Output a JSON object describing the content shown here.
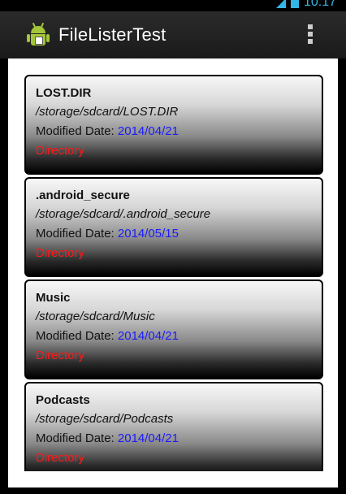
{
  "status_bar": {
    "time": "10:17",
    "icons": [
      "signal-icon",
      "battery-icon"
    ],
    "accent_color": "#33b5e5"
  },
  "action_bar": {
    "app_icon": "android-icon",
    "title": "FileListerTest",
    "overflow_icon": "overflow-menu-icon"
  },
  "colors": {
    "date": "#1a1aff",
    "type": "#ff1a1a"
  },
  "files": [
    {
      "name": "LOST.DIR",
      "path": "/storage/sdcard/LOST.DIR",
      "modified_label": "Modified Date:",
      "date": "2014/04/21",
      "type": "Directory"
    },
    {
      "name": ".android_secure",
      "path": "/storage/sdcard/.android_secure",
      "modified_label": "Modified Date:",
      "date": "2014/05/15",
      "type": "Directory"
    },
    {
      "name": "Music",
      "path": "/storage/sdcard/Music",
      "modified_label": "Modified Date:",
      "date": "2014/04/21",
      "type": "Directory"
    },
    {
      "name": "Podcasts",
      "path": "/storage/sdcard/Podcasts",
      "modified_label": "Modified Date:",
      "date": "2014/04/21",
      "type": "Directory"
    }
  ]
}
